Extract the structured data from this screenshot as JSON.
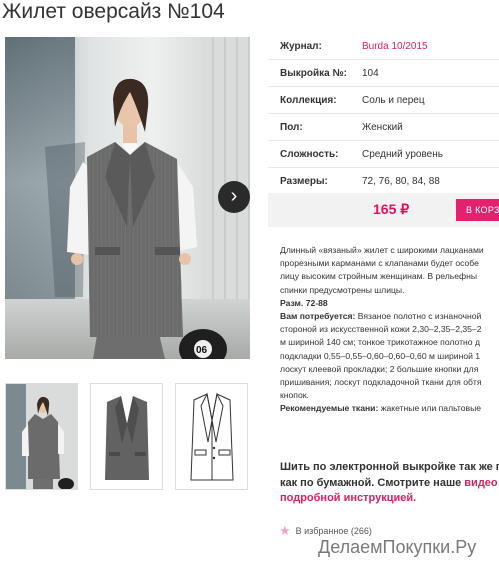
{
  "page": {
    "title": "Жилет оверсайз №104"
  },
  "info": {
    "rows": [
      {
        "label": "Журнал:",
        "value": "Burda 10/2015"
      },
      {
        "label": "Выкройка №:",
        "value": "104"
      },
      {
        "label": "Коллекция:",
        "value": "Соль и перец"
      },
      {
        "label": "Пол:",
        "value": "Женский"
      },
      {
        "label": "Сложность:",
        "value": "Средний уровень"
      },
      {
        "label": "Размеры:",
        "value": "72, 76, 80, 84, 88"
      }
    ]
  },
  "purchase": {
    "price": "165 ₽",
    "cart_label": "В КОРЗ"
  },
  "description": {
    "lines": [
      "Длинный «вязаный» жилет с широкими лацканами",
      "прорезными карманами с клапанами будет особе",
      "лицу высоким стройным женщинам. В рельефны",
      "спинки предусмотрены шлицы."
    ],
    "sizes_label": "Разм. 72-88",
    "needs_label": "Вам потребуется:",
    "needs_lines": [
      " Вязаное полотно с изнаночной",
      "стороной из искусственной кожи 2,30–2,35–2,35–2",
      "м шириной 140 см; тонкое трикотажное полотно д",
      "подкладки 0,55–0,55–0,60–0,60–0,60 м шириной 1",
      "лоскут клеевой прокладки; 2 большие кнопки для",
      "пришивания; лоскут подкладочной ткани для обтя",
      "кнопок."
    ],
    "fabrics_label": "Рекомендуемые ткани:",
    "fabrics_value": " жакетные или пальтовые"
  },
  "sew": {
    "line1": "Шить по электронной выкройке так же п",
    "line2_start": "как по бумажной. Смотрите наше ",
    "line2_link": "видео",
    "line3": "подробной инструкцией."
  },
  "favorites": {
    "label": "В избранное (266)"
  },
  "watermark": {
    "text": "ДелаемПокупки.Ру"
  },
  "icons": {
    "next": "chevron-right-icon",
    "favorite": "star-icon"
  },
  "colors": {
    "accent": "#e3216d",
    "link": "#d4245f",
    "price": "#e0115f"
  }
}
